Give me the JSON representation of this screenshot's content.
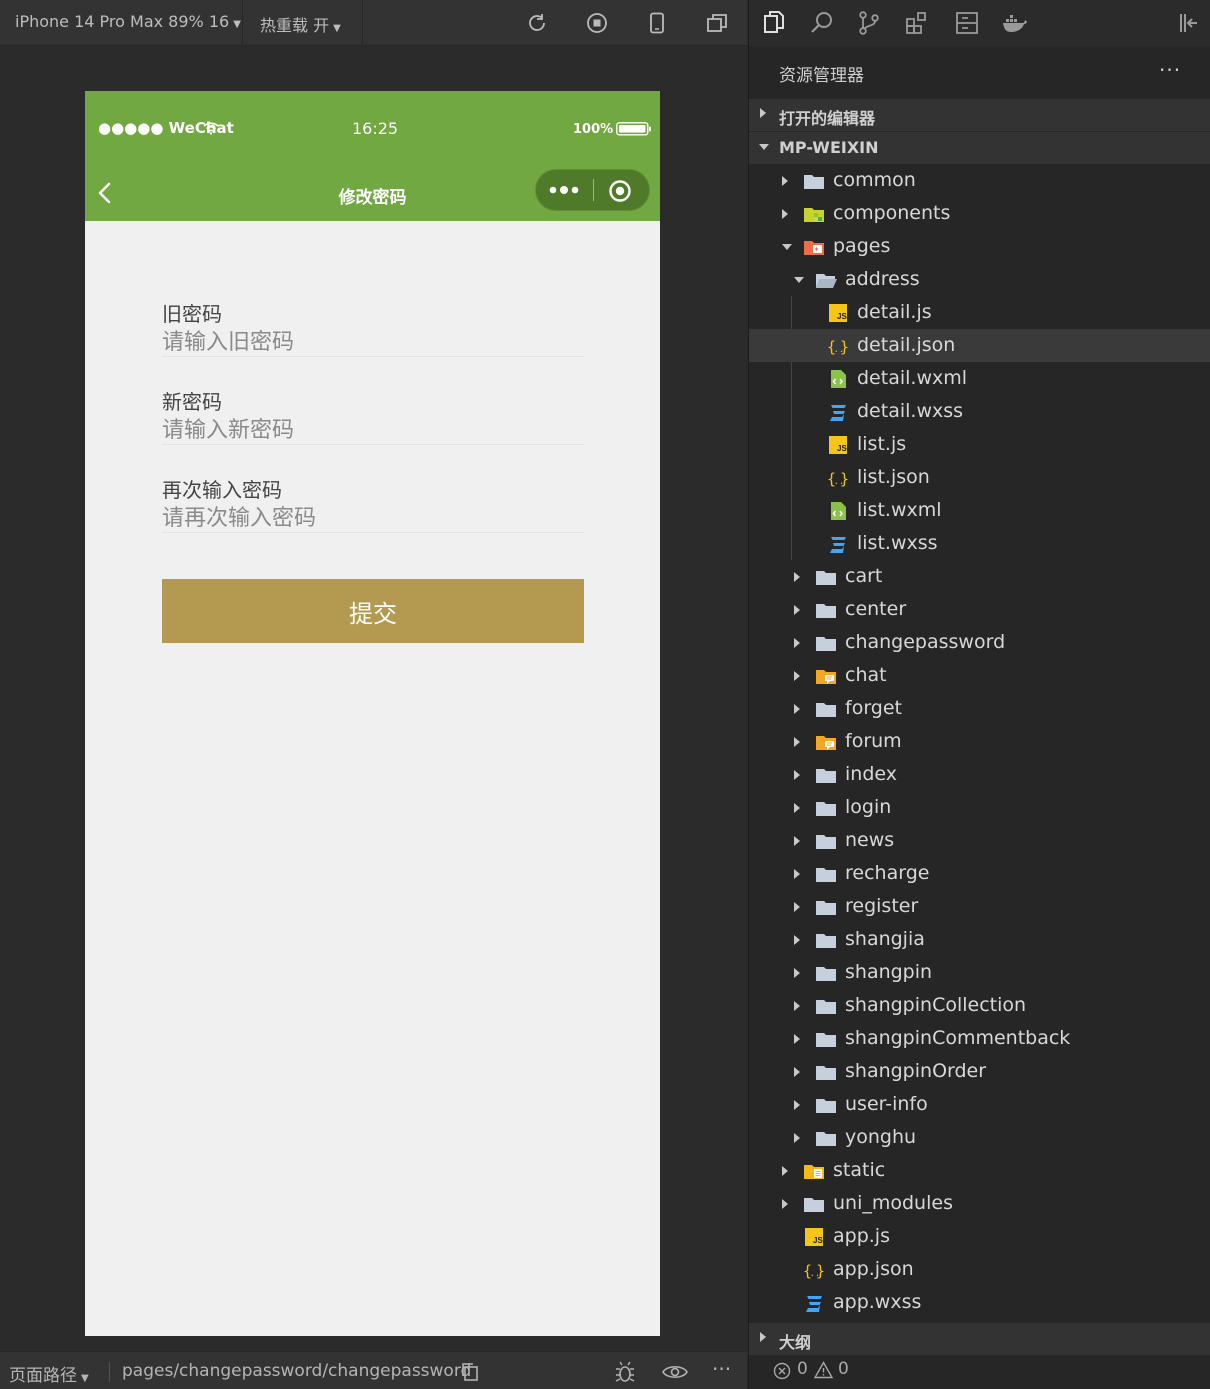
{
  "toolbar": {
    "device": "iPhone 14 Pro Max 89% 16",
    "hot_reload": "热重载 开"
  },
  "status_bar": {
    "carrier": "●●●●● WeChat",
    "time": "16:25",
    "battery": "100%"
  },
  "navbar": {
    "title": "修改密码"
  },
  "form": {
    "old_password": {
      "label": "旧密码",
      "placeholder": "请输入旧密码"
    },
    "new_password": {
      "label": "新密码",
      "placeholder": "请输入新密码"
    },
    "confirm_password": {
      "label": "再次输入密码",
      "placeholder": "请再次输入密码"
    },
    "submit_label": "提交"
  },
  "bottom_bar": {
    "path_label": "页面路径",
    "path": "pages/changepassword/changepassword",
    "more": "···"
  },
  "explorer": {
    "title": "资源管理器",
    "more": "···",
    "open_editors": "打开的编辑器",
    "project": "MP-WEIXIN",
    "outline": "大纲",
    "errors": "0",
    "warnings": "0",
    "tree": [
      {
        "label": "common",
        "icon": "folder-icon",
        "level": 1,
        "state": "collapsed"
      },
      {
        "label": "components",
        "icon": "components-folder-icon",
        "level": 1,
        "state": "collapsed"
      },
      {
        "label": "pages",
        "icon": "pages-folder-icon",
        "level": 1,
        "state": "expanded"
      },
      {
        "label": "address",
        "icon": "folder-open-icon",
        "level": 2,
        "state": "expanded"
      },
      {
        "label": "detail.js",
        "icon": "js-file-icon",
        "level": 3,
        "state": "file"
      },
      {
        "label": "detail.json",
        "icon": "json-file-icon",
        "level": 3,
        "state": "file",
        "selected": true
      },
      {
        "label": "detail.wxml",
        "icon": "wxml-file-icon",
        "level": 3,
        "state": "file"
      },
      {
        "label": "detail.wxss",
        "icon": "wxss-file-icon",
        "level": 3,
        "state": "file"
      },
      {
        "label": "list.js",
        "icon": "js-file-icon",
        "level": 3,
        "state": "file"
      },
      {
        "label": "list.json",
        "icon": "json-file-icon",
        "level": 3,
        "state": "file"
      },
      {
        "label": "list.wxml",
        "icon": "wxml-file-icon",
        "level": 3,
        "state": "file"
      },
      {
        "label": "list.wxss",
        "icon": "wxss-file-icon",
        "level": 3,
        "state": "file"
      },
      {
        "label": "cart",
        "icon": "folder-icon",
        "level": 2,
        "state": "collapsed"
      },
      {
        "label": "center",
        "icon": "folder-icon",
        "level": 2,
        "state": "collapsed"
      },
      {
        "label": "changepassword",
        "icon": "folder-icon",
        "level": 2,
        "state": "collapsed"
      },
      {
        "label": "chat",
        "icon": "chat-folder-icon",
        "level": 2,
        "state": "collapsed"
      },
      {
        "label": "forget",
        "icon": "folder-icon",
        "level": 2,
        "state": "collapsed"
      },
      {
        "label": "forum",
        "icon": "chat-folder-icon",
        "level": 2,
        "state": "collapsed"
      },
      {
        "label": "index",
        "icon": "folder-icon",
        "level": 2,
        "state": "collapsed"
      },
      {
        "label": "login",
        "icon": "folder-icon",
        "level": 2,
        "state": "collapsed"
      },
      {
        "label": "news",
        "icon": "folder-icon",
        "level": 2,
        "state": "collapsed"
      },
      {
        "label": "recharge",
        "icon": "folder-icon",
        "level": 2,
        "state": "collapsed"
      },
      {
        "label": "register",
        "icon": "folder-icon",
        "level": 2,
        "state": "collapsed"
      },
      {
        "label": "shangjia",
        "icon": "folder-icon",
        "level": 2,
        "state": "collapsed"
      },
      {
        "label": "shangpin",
        "icon": "folder-icon",
        "level": 2,
        "state": "collapsed"
      },
      {
        "label": "shangpinCollection",
        "icon": "folder-icon",
        "level": 2,
        "state": "collapsed"
      },
      {
        "label": "shangpinCommentback",
        "icon": "folder-icon",
        "level": 2,
        "state": "collapsed"
      },
      {
        "label": "shangpinOrder",
        "icon": "folder-icon",
        "level": 2,
        "state": "collapsed"
      },
      {
        "label": "user-info",
        "icon": "folder-icon",
        "level": 2,
        "state": "collapsed"
      },
      {
        "label": "yonghu",
        "icon": "folder-icon",
        "level": 2,
        "state": "collapsed"
      },
      {
        "label": "static",
        "icon": "static-folder-icon",
        "level": 1,
        "state": "collapsed"
      },
      {
        "label": "uni_modules",
        "icon": "folder-icon",
        "level": 1,
        "state": "collapsed"
      },
      {
        "label": "app.js",
        "icon": "js-file-icon",
        "level": 1,
        "state": "file"
      },
      {
        "label": "app.json",
        "icon": "json-file-icon",
        "level": 1,
        "state": "file"
      },
      {
        "label": "app.wxss",
        "icon": "wxss-file-icon",
        "level": 1,
        "state": "file"
      }
    ]
  },
  "colors": {
    "wechat_green": "#72a842",
    "submit_gold": "#b39a50",
    "folder_blue": "#c5d0dc",
    "js_yellow": "#f5c518",
    "wxml_green": "#8bc34a",
    "wxss_blue": "#42a5f5"
  }
}
